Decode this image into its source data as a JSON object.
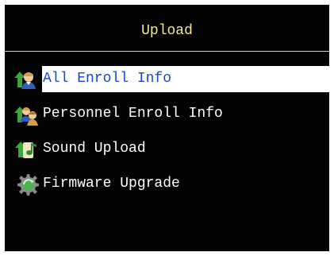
{
  "header": {
    "title": "Upload"
  },
  "menu": {
    "items": [
      {
        "label": "All Enroll Info",
        "icon": "user-upload-icon",
        "selected": true
      },
      {
        "label": "Personnel Enroll Info",
        "icon": "users-upload-icon",
        "selected": false
      },
      {
        "label": "Sound Upload",
        "icon": "music-note-upload-icon",
        "selected": false
      },
      {
        "label": "Firmware Upgrade",
        "icon": "gear-upgrade-icon",
        "selected": false
      }
    ]
  },
  "colors": {
    "screen_background": "#020202",
    "title_text": "#f5e98f",
    "menu_text": "#ffffff",
    "selected_background": "#ffffff",
    "selected_text": "#1a46c7",
    "divider": "#cfcfcf"
  }
}
